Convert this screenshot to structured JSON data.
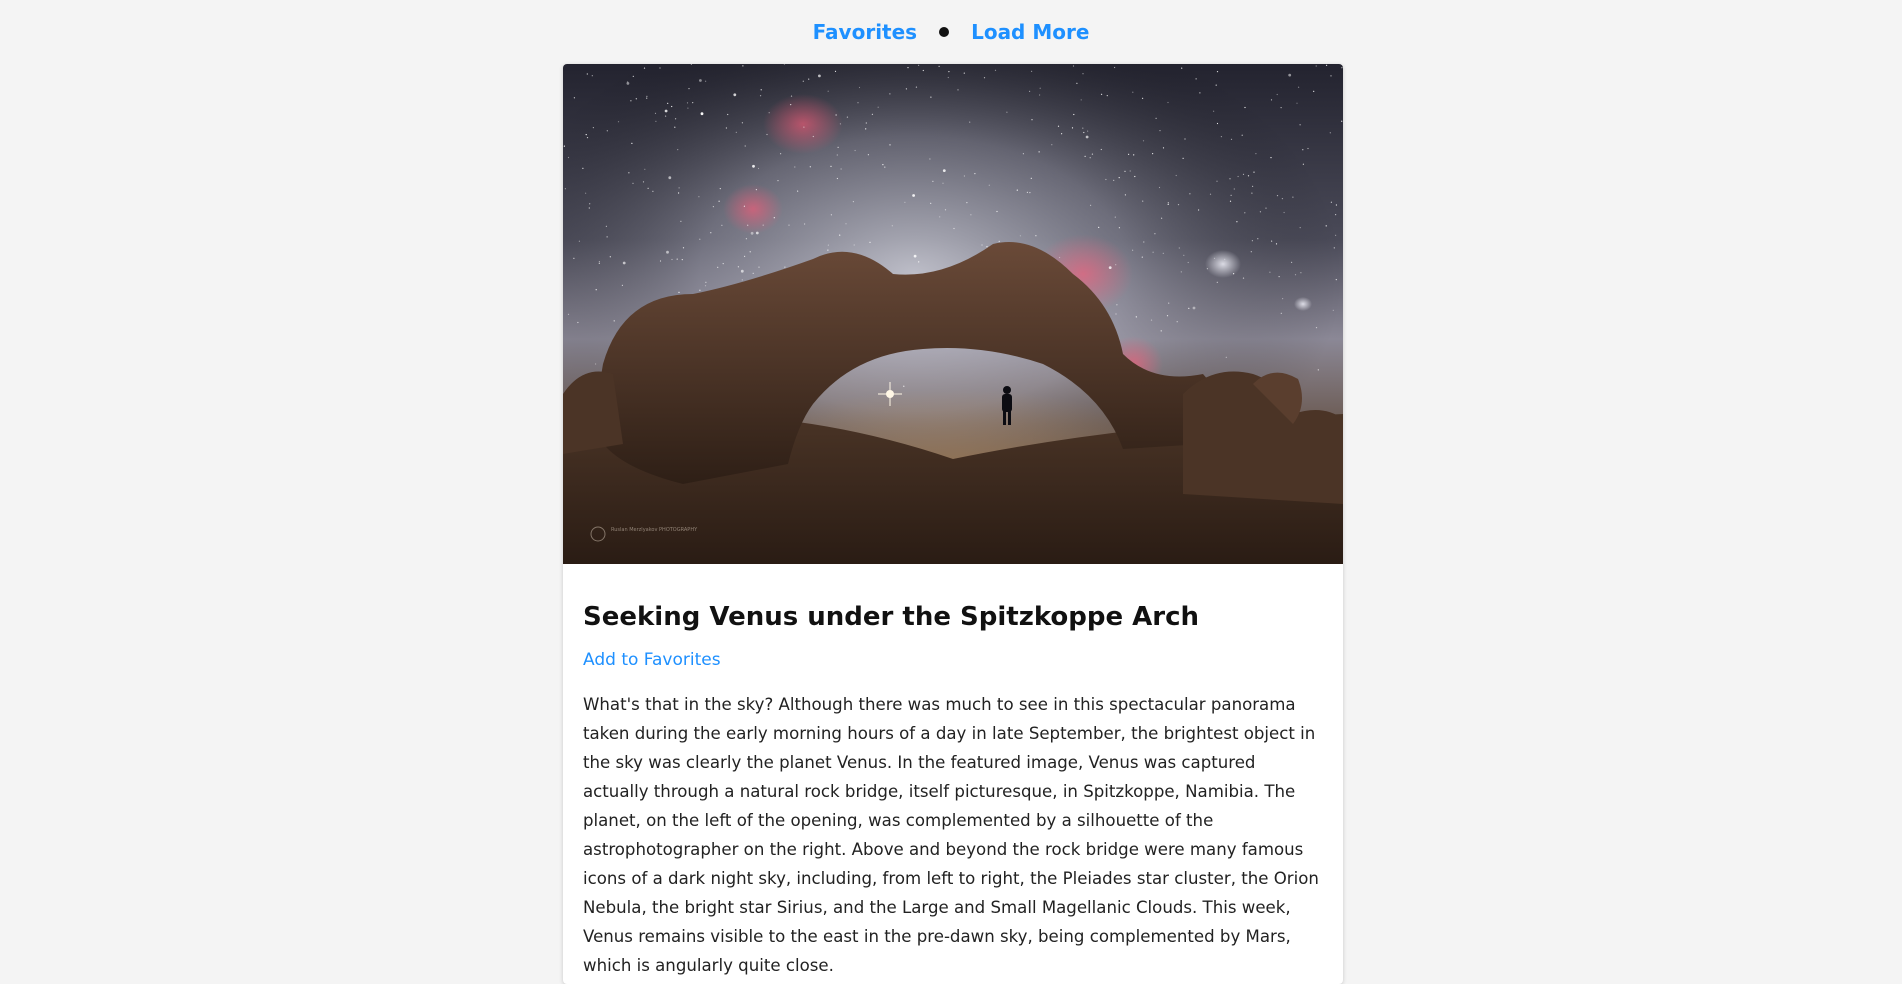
{
  "nav": {
    "favorites_label": "Favorites",
    "load_more_label": "Load More"
  },
  "colors": {
    "link": "#1e90ff",
    "background": "#f4f4f4",
    "card": "#ffffff"
  },
  "post": {
    "image_alt": "Night sky panorama over a natural rock arch with a silhouetted person",
    "image_watermark": "Ruslan Merzlyakov PHOTOGRAPHY",
    "title": "Seeking Venus under the Spitzkoppe Arch",
    "add_favorites_label": "Add to Favorites",
    "description": "What's that in the sky? Although there was much to see in this spectacular panorama taken during the early morning hours of a day in late September, the brightest object in the sky was clearly the planet Venus. In the featured image, Venus was captured actually through a natural rock bridge, itself picturesque, in Spitzkoppe, Namibia. The planet, on the left of the opening, was complemented by a silhouette of the astrophotographer on the right. Above and beyond the rock bridge were many famous icons of a dark night sky, including, from left to right, the Pleiades star cluster, the Orion Nebula, the bright star Sirius, and the Large and Small Magellanic Clouds. This week, Venus remains visible to the east in the pre-dawn sky, being complemented by Mars, which is angularly quite close."
  }
}
